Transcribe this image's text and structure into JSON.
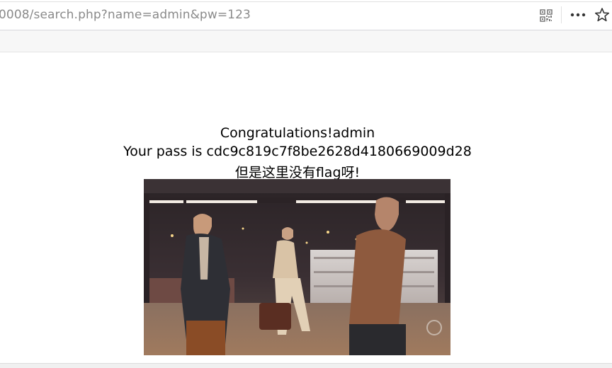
{
  "browser": {
    "url_partial": "0008/search.php?name=admin&pw=123",
    "icons": {
      "qr": "qr-code-icon",
      "more": "more-icon",
      "bookmark": "star-icon"
    }
  },
  "page": {
    "line1": "Congratulations!admin",
    "line2": "Your pass is cdc9c819c7f8be2628d4180669009d28",
    "line3": "但是这里没有flag呀!"
  },
  "colors": {
    "url_text": "#8a8a8a",
    "page_bg": "#ffffff",
    "text": "#000000"
  }
}
